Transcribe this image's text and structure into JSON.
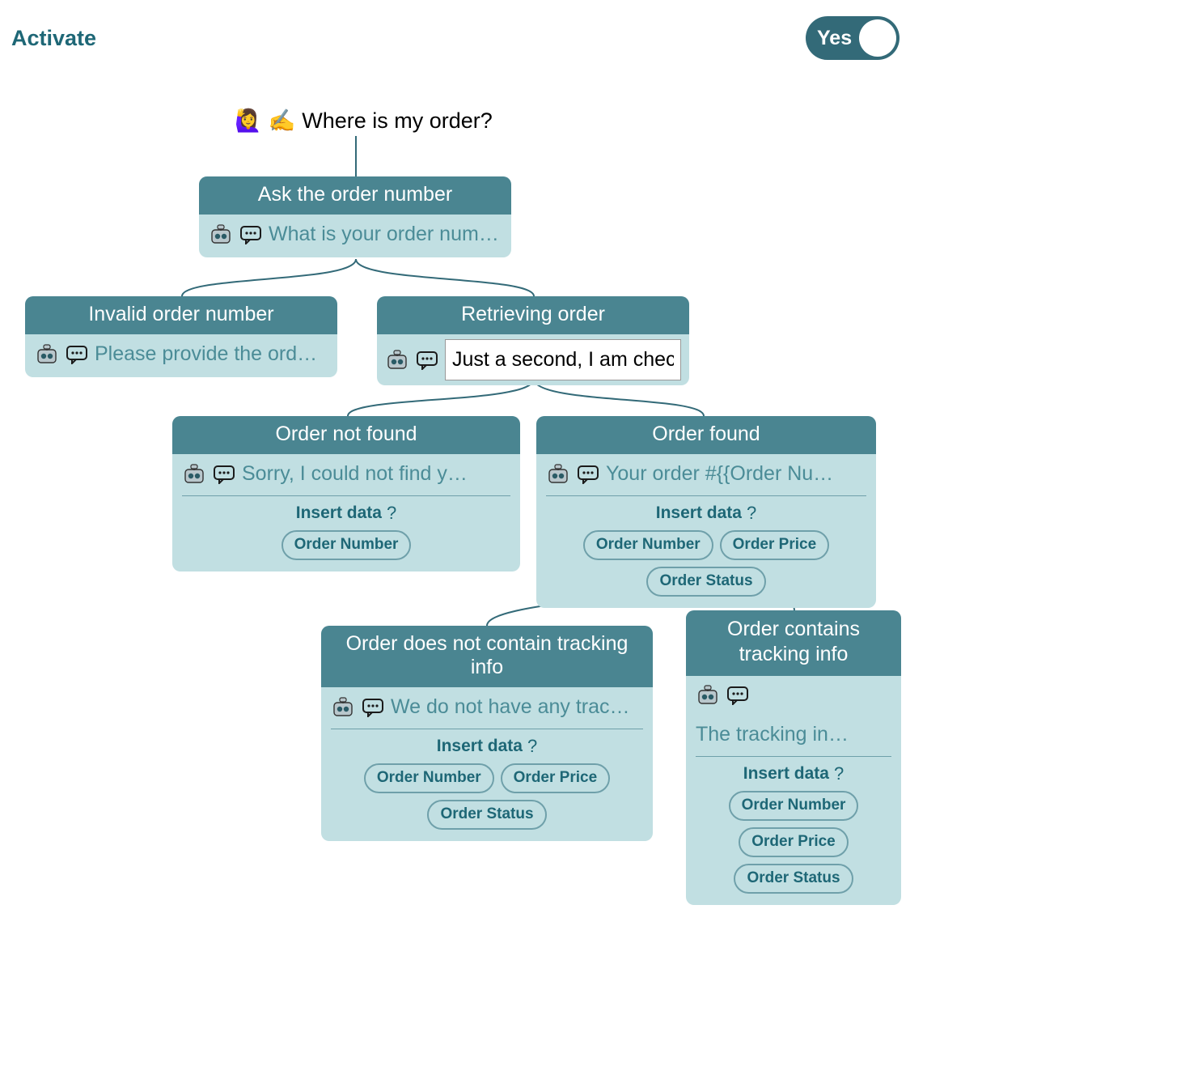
{
  "activate": {
    "label": "Activate",
    "toggle_label": "Yes",
    "toggle_on": true
  },
  "root": {
    "question": "Where is my order?"
  },
  "nodes": {
    "ask_number": {
      "title": "Ask the order number",
      "message": "What is your order num…"
    },
    "invalid": {
      "title": "Invalid order number",
      "message": "Please provide the ord…"
    },
    "retrieving": {
      "title": "Retrieving order",
      "editing_value": "Just a second, I am check"
    },
    "not_found": {
      "title": "Order not found",
      "message": "Sorry, I could not find y…",
      "insert_label": "Insert data",
      "chips": [
        "Order Number"
      ]
    },
    "found": {
      "title": "Order found",
      "message": "Your order #{{Order Nu…",
      "insert_label": "Insert data",
      "chips": [
        "Order Number",
        "Order Price",
        "Order Status"
      ]
    },
    "no_tracking": {
      "title": "Order does not contain tracking info",
      "message": "We do not have any trac…",
      "insert_label": "Insert data",
      "chips": [
        "Order Number",
        "Order Price",
        "Order Status"
      ]
    },
    "has_tracking": {
      "title": "Order contains tracking info",
      "message": "The tracking in…",
      "insert_label": "Insert data",
      "chips": [
        "Order Number",
        "Order Price",
        "Order Status"
      ]
    }
  }
}
